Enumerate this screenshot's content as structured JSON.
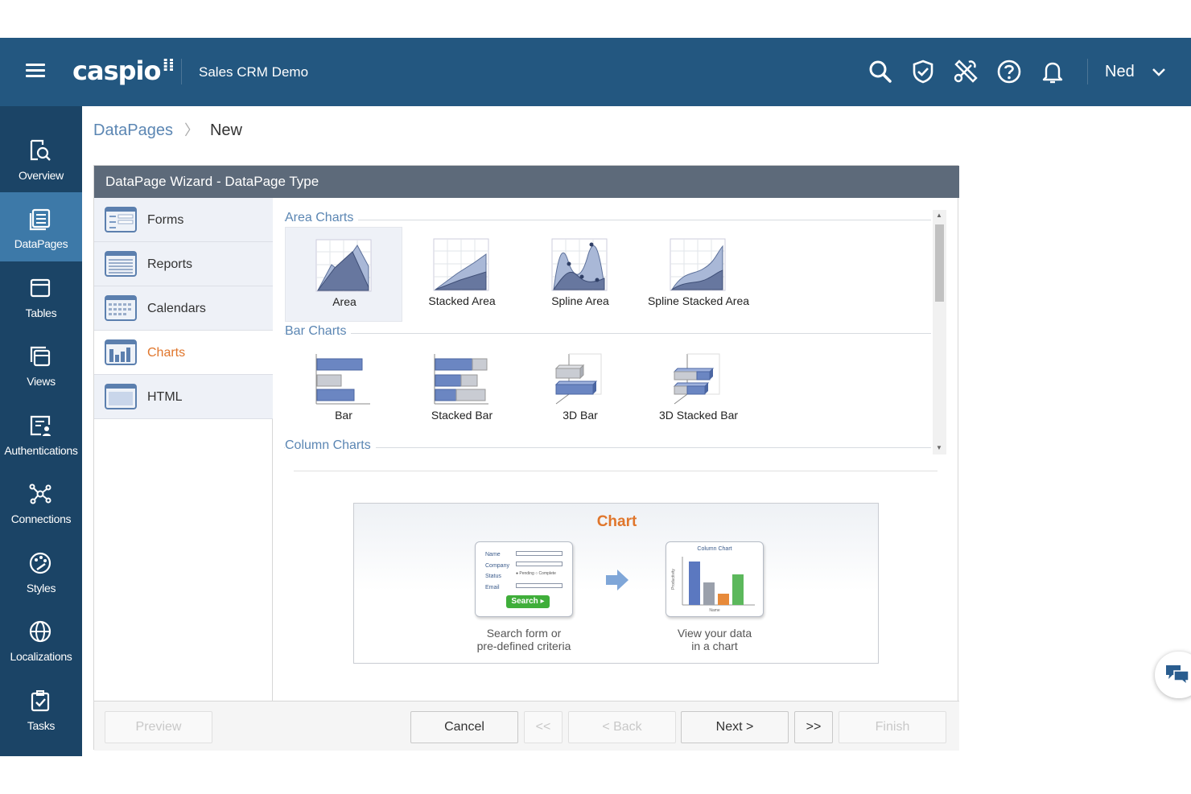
{
  "header": {
    "logo": "caspio",
    "app_name": "Sales CRM Demo",
    "user_name": "Ned",
    "icons": [
      "search-icon",
      "shield-icon",
      "tools-icon",
      "help-icon",
      "bell-icon"
    ]
  },
  "nav": {
    "items": [
      {
        "label": "Overview",
        "icon": "overview-icon"
      },
      {
        "label": "DataPages",
        "icon": "datapages-icon",
        "active": true
      },
      {
        "label": "Tables",
        "icon": "tables-icon"
      },
      {
        "label": "Views",
        "icon": "views-icon"
      },
      {
        "label": "Authentications",
        "icon": "authentications-icon"
      },
      {
        "label": "Connections",
        "icon": "connections-icon"
      },
      {
        "label": "Styles",
        "icon": "styles-icon"
      },
      {
        "label": "Localizations",
        "icon": "localizations-icon"
      },
      {
        "label": "Tasks",
        "icon": "tasks-icon"
      }
    ]
  },
  "breadcrumb": {
    "parent": "DataPages",
    "current": "New"
  },
  "wizard": {
    "title": "DataPage Wizard - DataPage Type",
    "types": [
      {
        "label": "Forms"
      },
      {
        "label": "Reports"
      },
      {
        "label": "Calendars"
      },
      {
        "label": "Charts",
        "active": true
      },
      {
        "label": "HTML"
      }
    ],
    "sections": [
      {
        "title": "Area Charts",
        "items": [
          "Area",
          "Stacked Area",
          "Spline Area",
          "Spline Stacked Area"
        ]
      },
      {
        "title": "Bar Charts",
        "items": [
          "Bar",
          "Stacked Bar",
          "3D Bar",
          "3D Stacked Bar"
        ]
      },
      {
        "title": "Column Charts",
        "items": []
      }
    ],
    "selected_item": "Area",
    "preview": {
      "title": "Chart",
      "left_caption_1": "Search form or",
      "left_caption_2": "pre-defined criteria",
      "right_caption_1": "View your data",
      "right_caption_2": "in a chart",
      "form_fields": [
        "Name",
        "Company",
        "Status",
        "Email"
      ],
      "form_status_options": "● Pending  ○ Complete",
      "search_button": "Search ▸",
      "mini_chart_title": "Column Chart",
      "mini_chart_ylabel": "Productivity",
      "mini_chart_xlabel": "Name"
    },
    "buttons": {
      "preview": "Preview",
      "cancel": "Cancel",
      "first": "<<",
      "back": "< Back",
      "next": "Next >",
      "last": ">>",
      "finish": "Finish"
    }
  },
  "colors": {
    "header_bg": "#235780",
    "nav_bg": "#1b4466",
    "nav_active": "#3d79a8",
    "accent_orange": "#e0762c",
    "link_blue": "#5b86b3"
  }
}
